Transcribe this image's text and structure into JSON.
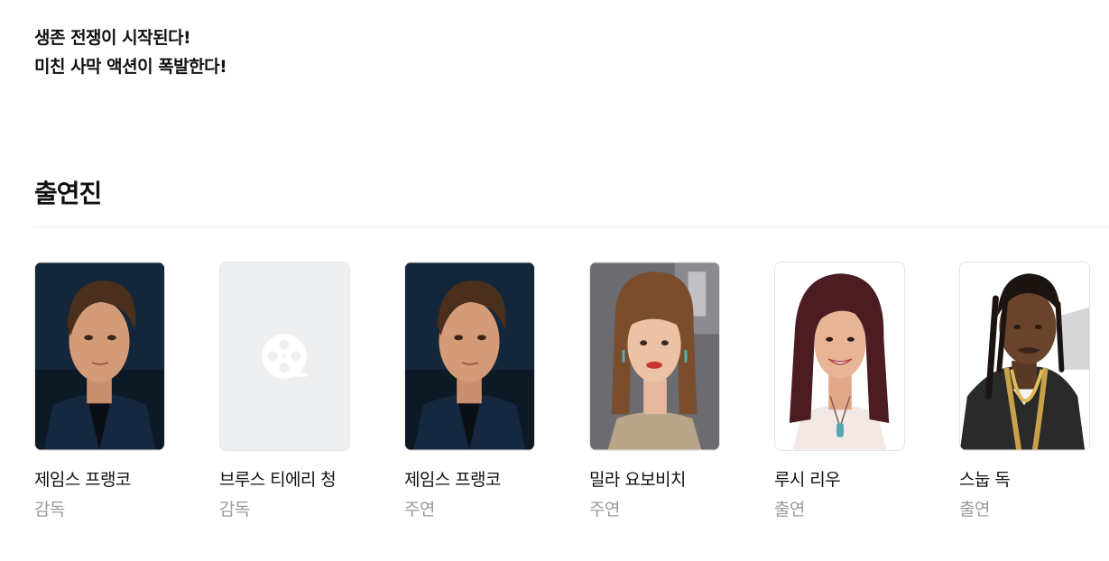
{
  "synopsis": {
    "line1": "생존 전쟁이 시작된다!",
    "line2": "미친 사막 액션이 폭발한다!"
  },
  "cast_section": {
    "title": "출연진",
    "members": [
      {
        "name": "제임스 프랭코",
        "role": "감독",
        "photo": "portrait-dark-suit"
      },
      {
        "name": "브루스 티에리 청",
        "role": "감독",
        "photo": "placeholder-film-reel-icon"
      },
      {
        "name": "제임스 프랭코",
        "role": "주연",
        "photo": "portrait-dark-suit"
      },
      {
        "name": "밀라 요보비치",
        "role": "주연",
        "photo": "portrait-brown-hair"
      },
      {
        "name": "루시 리우",
        "role": "출연",
        "photo": "portrait-white-background"
      },
      {
        "name": "스눕 독",
        "role": "출연",
        "photo": "portrait-braids-chain"
      }
    ]
  }
}
